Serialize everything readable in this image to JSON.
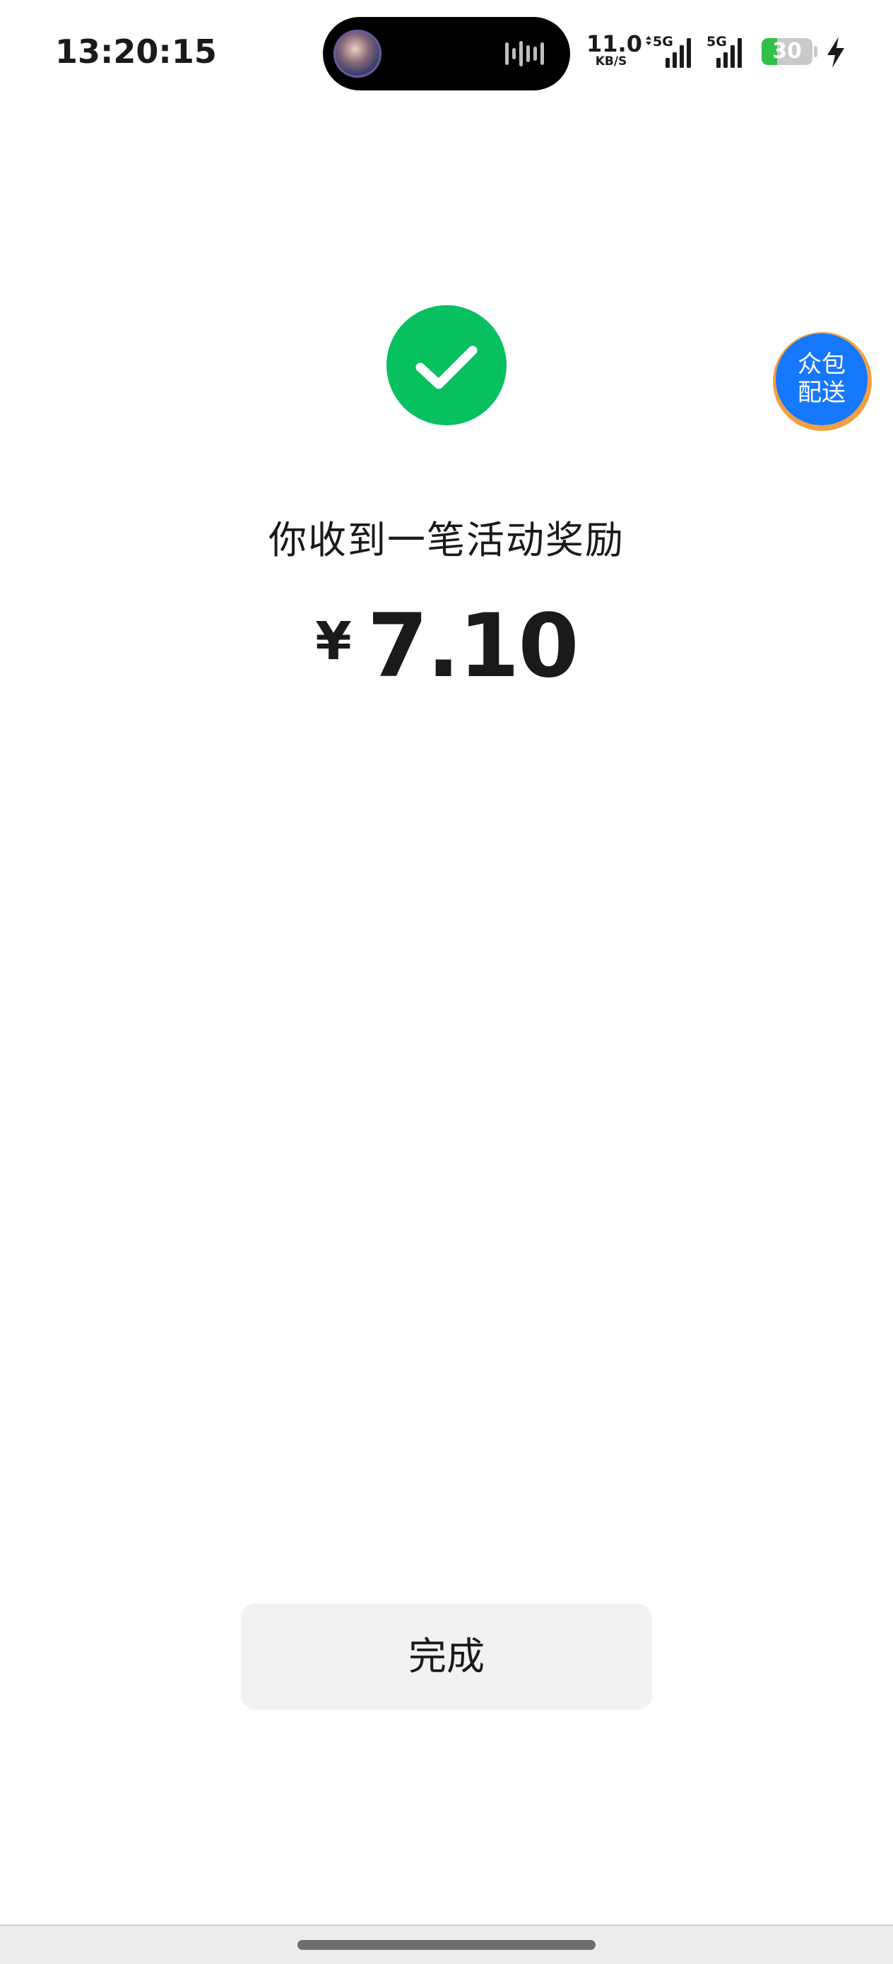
{
  "status_bar": {
    "time": "13:20:15",
    "net_speed_value": "11.0",
    "net_speed_unit": "KB/S",
    "signal_1_label": "5G",
    "signal_2_label": "5G",
    "battery_level": "30",
    "battery_fraction": 0.3,
    "icons": [
      "media-avatar-icon",
      "audio-wave-icon",
      "signal-icon",
      "battery-icon",
      "charging-icon"
    ]
  },
  "main": {
    "success_icon": "checkmark-icon",
    "message": "你收到一笔活动奖励",
    "currency_symbol": "¥",
    "amount": "7.10"
  },
  "float_badge": {
    "line1": "众包",
    "line2": "配送"
  },
  "actions": {
    "done_label": "完成"
  },
  "colors": {
    "success_green": "#07c160",
    "badge_blue": "#1677ff",
    "badge_ring": "#f0a040",
    "battery_green": "#2fc046",
    "button_bg": "#f2f2f2"
  }
}
